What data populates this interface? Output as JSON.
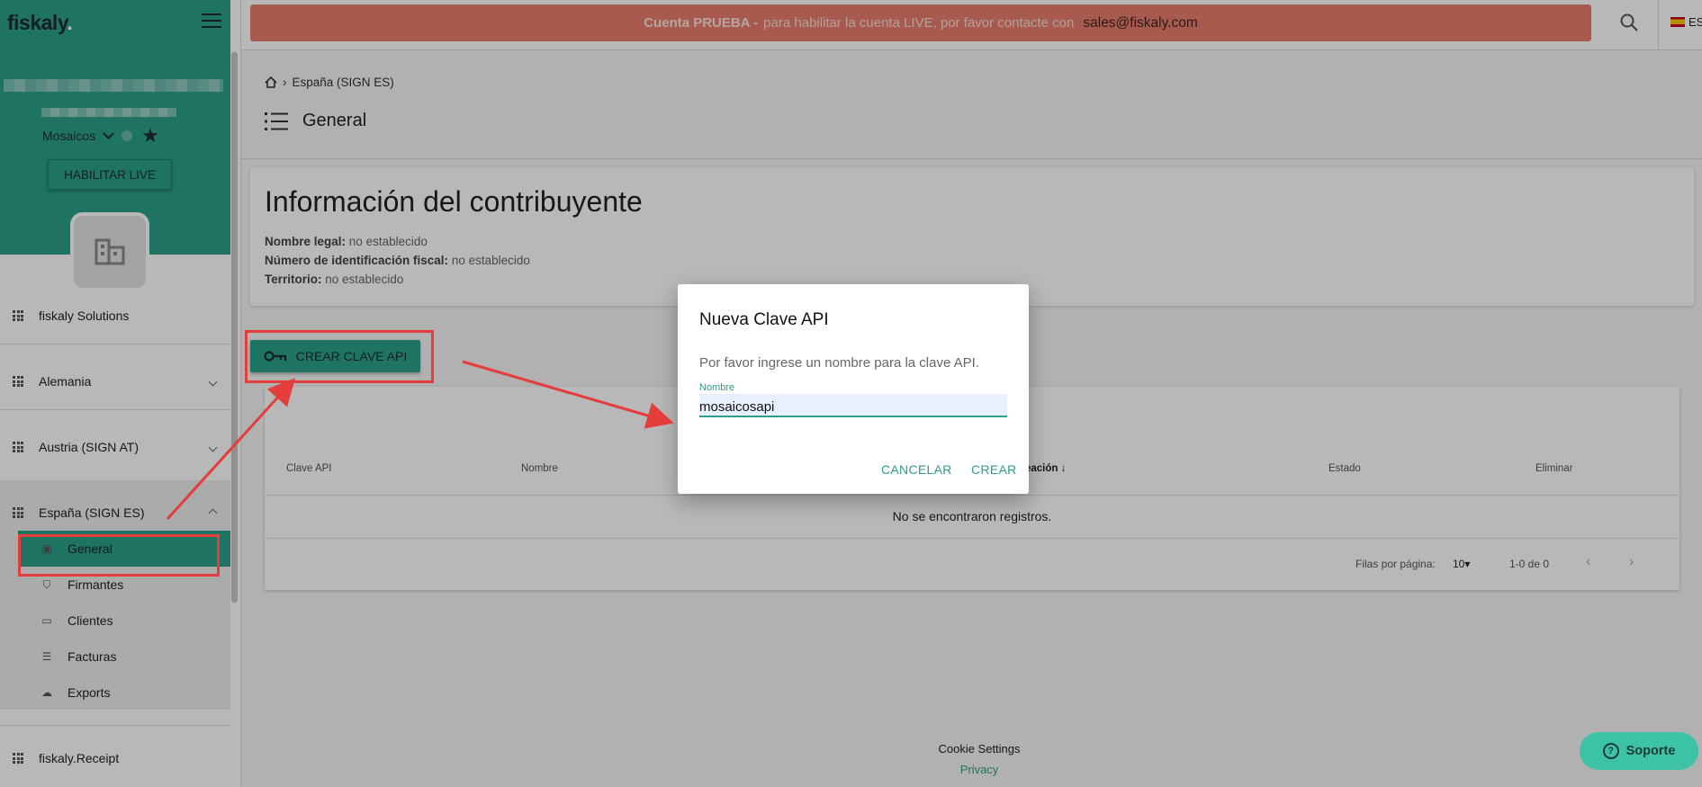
{
  "app": {
    "logo": "fiskaly",
    "logo_dot": "."
  },
  "banner": {
    "strong": "Cuenta PRUEBA -",
    "text": "para habilitar la cuenta LIVE, por favor contacte con",
    "email": "sales@fiskaly.com"
  },
  "topbar": {
    "lang": "ES"
  },
  "sidebar": {
    "account_name": "Mosaicos",
    "enable_live": "HABILITAR LIVE",
    "items": [
      {
        "label": "fiskaly Solutions"
      },
      {
        "label": "Alemania"
      },
      {
        "label": "Austria (SIGN AT)"
      },
      {
        "label": "España (SIGN ES)"
      },
      {
        "label": "fiskaly.Receipt"
      }
    ],
    "sub_items": [
      {
        "label": "General"
      },
      {
        "label": "Firmantes"
      },
      {
        "label": "Clientes"
      },
      {
        "label": "Facturas"
      },
      {
        "label": "Exports"
      }
    ]
  },
  "breadcrumb": {
    "current": "España (SIGN ES)"
  },
  "page": {
    "title": "General"
  },
  "taxpayer": {
    "title": "Información del contribuyente",
    "legal_name_label": "Nombre legal:",
    "legal_name_value": "no establecido",
    "tax_id_label": "Número de identificación fiscal:",
    "tax_id_value": "no establecido",
    "territory_label": "Territorio:",
    "territory_value": "no establecido"
  },
  "actions": {
    "create_key": "CREAR CLAVE API"
  },
  "table": {
    "headers": [
      "Clave API",
      "Nombre",
      "eación",
      "Estado",
      "Eliminar"
    ],
    "empty": "No se encontraron registros.",
    "rows_per_page_label": "Filas por página:",
    "rows_per_page_value": "10",
    "range": "1-0 de 0"
  },
  "dialog": {
    "title": "Nueva Clave API",
    "text": "Por favor ingrese un nombre para la clave API.",
    "field_label": "Nombre",
    "field_value": "mosaicosapi",
    "cancel": "CANCELAR",
    "create": "CREAR"
  },
  "footer": {
    "cookie": "Cookie Settings",
    "privacy": "Privacy"
  },
  "support": {
    "label": "Soporte"
  },
  "colors": {
    "accent": "#2aa08a",
    "banner": "#e97d6c",
    "annotation": "#e53c3c"
  }
}
